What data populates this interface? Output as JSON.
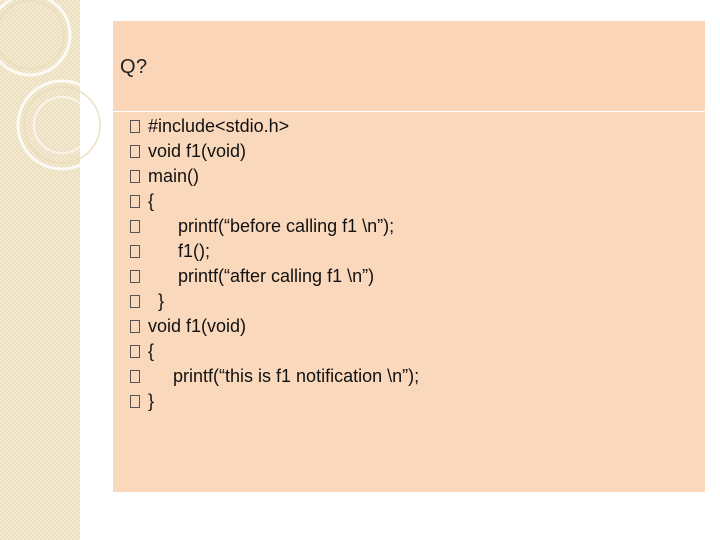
{
  "slide": {
    "title": "Q?",
    "code_lines": [
      {
        "indent": "",
        "text": "#include<stdio.h>"
      },
      {
        "indent": "",
        "text": "void f1(void)"
      },
      {
        "indent": "",
        "text": "main()"
      },
      {
        "indent": "",
        "text": "{"
      },
      {
        "indent": "      ",
        "text": "printf(“before calling f1 \\n”);"
      },
      {
        "indent": "      ",
        "text": "f1();"
      },
      {
        "indent": "      ",
        "text": "printf(“after calling f1 \\n”)"
      },
      {
        "indent": "  ",
        "text": "}"
      },
      {
        "indent": "",
        "text": "void f1(void)"
      },
      {
        "indent": "",
        "text": "{"
      },
      {
        "indent": "     ",
        "text": "printf(“this is f1 notification \\n”);"
      },
      {
        "indent": "",
        "text": "}"
      }
    ]
  },
  "colors": {
    "panel": "#fad8bc",
    "strip": "#f4e9cf",
    "text": "#111111"
  },
  "icons": {
    "bullet": "square-bullet-icon"
  }
}
